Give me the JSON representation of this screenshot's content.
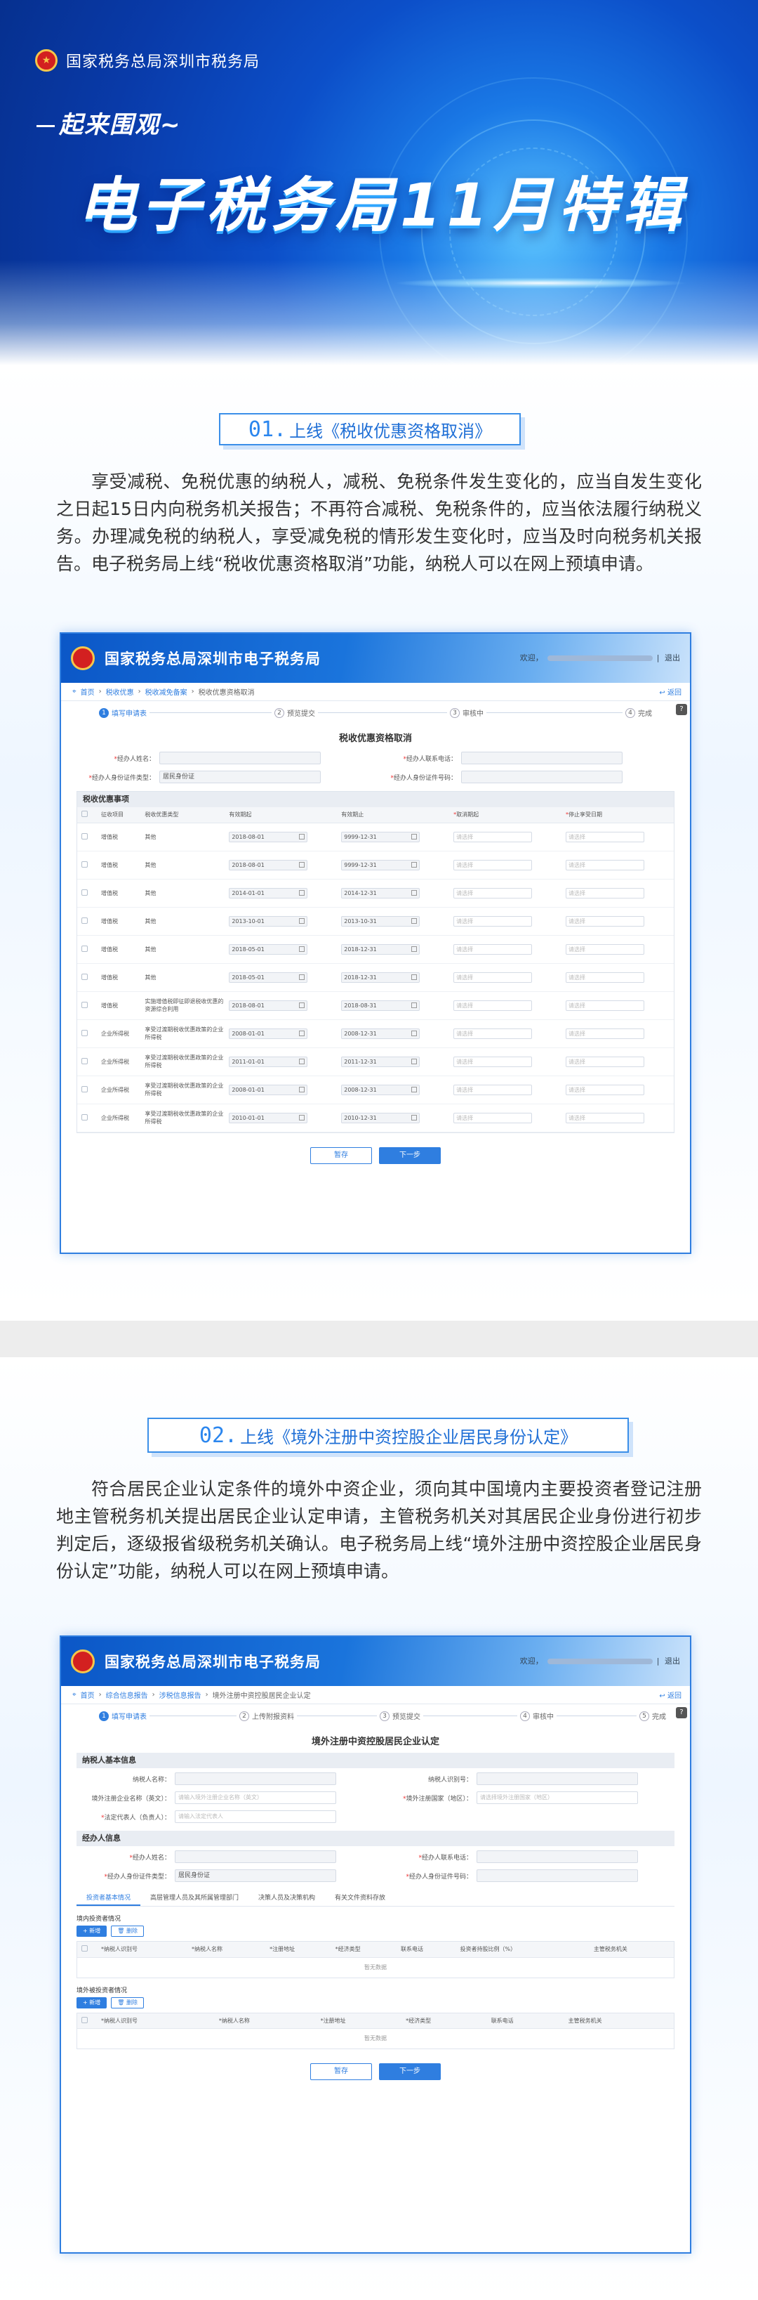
{
  "hero": {
    "org": "国家税务总局深圳市税务局",
    "slogan": "起来围观~",
    "title": "电子税务局11月特辑"
  },
  "section1": {
    "number": "01.",
    "title": "上线《税收优惠资格取消》",
    "paragraph": "享受减税、免税优惠的纳税人，减税、免税条件发生变化的，应当自发生变化之日起15日内向税务机关报告；不再符合减税、免税条件的，应当依法履行纳税义务。办理减免税的纳税人，享受减免税的情形发生变化时，应当及时向税务机关报告。电子税务局上线“税收优惠资格取消”功能，纳税人可以在网上预填申请。",
    "app": {
      "name": "国家税务总局深圳市电子税务局",
      "welcome": "欢迎，",
      "logout": "退出",
      "breadcrumb": [
        "首页",
        "税收优惠",
        "税收减免备案",
        "税收优惠资格取消"
      ],
      "back": "返回",
      "steps": [
        "填写申请表",
        "预览提交",
        "审核中",
        "完成"
      ],
      "form_title": "税收优惠资格取消",
      "fields": {
        "agent_name": "经办人姓名：",
        "agent_phone": "经办人联系电话：",
        "agent_id_type": "经办人身份证件类型：",
        "agent_id_type_value": "居民身份证",
        "agent_id_no": "经办人身份证件号码："
      },
      "panel_title": "税收优惠事项",
      "columns": [
        "征收项目",
        "税收优惠类型",
        "有效期起",
        "有效期止",
        "取消期起",
        "停止享受日期"
      ],
      "rows": [
        {
          "item": "增值税",
          "type": "其他",
          "start": "2018-08-01",
          "end": "9999-12-31"
        },
        {
          "item": "增值税",
          "type": "其他",
          "start": "2018-08-01",
          "end": "9999-12-31"
        },
        {
          "item": "增值税",
          "type": "其他",
          "start": "2014-01-01",
          "end": "2014-12-31"
        },
        {
          "item": "增值税",
          "type": "其他",
          "start": "2013-10-01",
          "end": "2013-10-31"
        },
        {
          "item": "增值税",
          "type": "其他",
          "start": "2018-05-01",
          "end": "2018-12-31"
        },
        {
          "item": "增值税",
          "type": "其他",
          "start": "2018-05-01",
          "end": "2018-12-31"
        },
        {
          "item": "增值税",
          "type": "实施增值税即征即退税收优惠的资源综合利用",
          "start": "2018-08-01",
          "end": "2018-08-31"
        },
        {
          "item": "企业所得税",
          "type": "享受过渡期税收优惠政策的企业所得税",
          "start": "2008-01-01",
          "end": "2008-12-31"
        },
        {
          "item": "企业所得税",
          "type": "享受过渡期税收优惠政策的企业所得税",
          "start": "2011-01-01",
          "end": "2011-12-31"
        },
        {
          "item": "企业所得税",
          "type": "享受过渡期税收优惠政策的企业所得税",
          "start": "2008-01-01",
          "end": "2008-12-31"
        },
        {
          "item": "企业所得税",
          "type": "享受过渡期税收优惠政策的企业所得税",
          "start": "2010-01-01",
          "end": "2010-12-31"
        }
      ],
      "placeholder": "请选择",
      "save": "暂存",
      "next": "下一步"
    }
  },
  "section2": {
    "number": "02.",
    "title": "上线《境外注册中资控股企业居民身份认定》",
    "paragraph": "符合居民企业认定条件的境外中资企业，须向其中国境内主要投资者登记注册地主管税务机关提出居民企业认定申请，主管税务机关对其居民企业身份进行初步判定后，逐级报省级税务机关确认。电子税务局上线“境外注册中资控股企业居民身份认定”功能，纳税人可以在网上预填申请。",
    "app": {
      "name": "国家税务总局深圳市电子税务局",
      "welcome": "欢迎，",
      "logout": "退出",
      "breadcrumb": [
        "首页",
        "综合信息报告",
        "涉税信息报告",
        "境外注册中资控股居民企业认定"
      ],
      "back": "返回",
      "steps": [
        "填写申请表",
        "上传附报资料",
        "预览提交",
        "审核中",
        "完成"
      ],
      "form_title": "境外注册中资控股居民企业认定",
      "basic_title": "纳税人基本信息",
      "fields": {
        "taxpayer_name": "纳税人名称：",
        "taxpayer_id": "纳税人识别号：",
        "foreign_name": "境外注册企业名称（英文）：",
        "foreign_name_ph": "请输入境外注册企业名称（英文）",
        "region": "境外注册国家（地区）：",
        "region_ph": "请选择境外注册国家（地区）",
        "legal_rep": "法定代表人（负责人）：",
        "legal_rep_ph": "请输入法定代表人"
      },
      "agent_title": "经办人信息",
      "agent_fields": {
        "agent_name": "经办人姓名：",
        "agent_phone": "经办人联系电话：",
        "agent_id_type": "经办人身份证件类型：",
        "agent_id_type_value": "居民身份证",
        "agent_id_no": "经办人身份证件号码："
      },
      "tabs": [
        "投资者基本情况",
        "高层管理人员及其所属管理部门",
        "决策人员及决策机构",
        "有关文件资料存放"
      ],
      "domestic_title": "境内投资者情况",
      "foreign_title": "境外被投资者情况",
      "add": "+ 新增",
      "delete": "删除",
      "cols1": [
        "*纳税人识别号",
        "*纳税人名称",
        "*注册地址",
        "*经济类型",
        "联系电话",
        "投资者持股比例（%）",
        "主管税务机关"
      ],
      "cols2": [
        "*纳税人识别号",
        "*纳税人名称",
        "*注册地址",
        "*经济类型",
        "联系电话",
        "主管税务机关"
      ],
      "empty": "暂无数据",
      "save": "暂存",
      "next": "下一步"
    }
  },
  "colors": {
    "brand_blue": "#2f7ee0",
    "hero_dark": "#093aa8",
    "accent_light": "#cfe3fb"
  },
  "icons": [
    "national-emblem-icon",
    "location-pin-icon",
    "back-arrow-icon",
    "calendar-icon",
    "help-icon"
  ]
}
